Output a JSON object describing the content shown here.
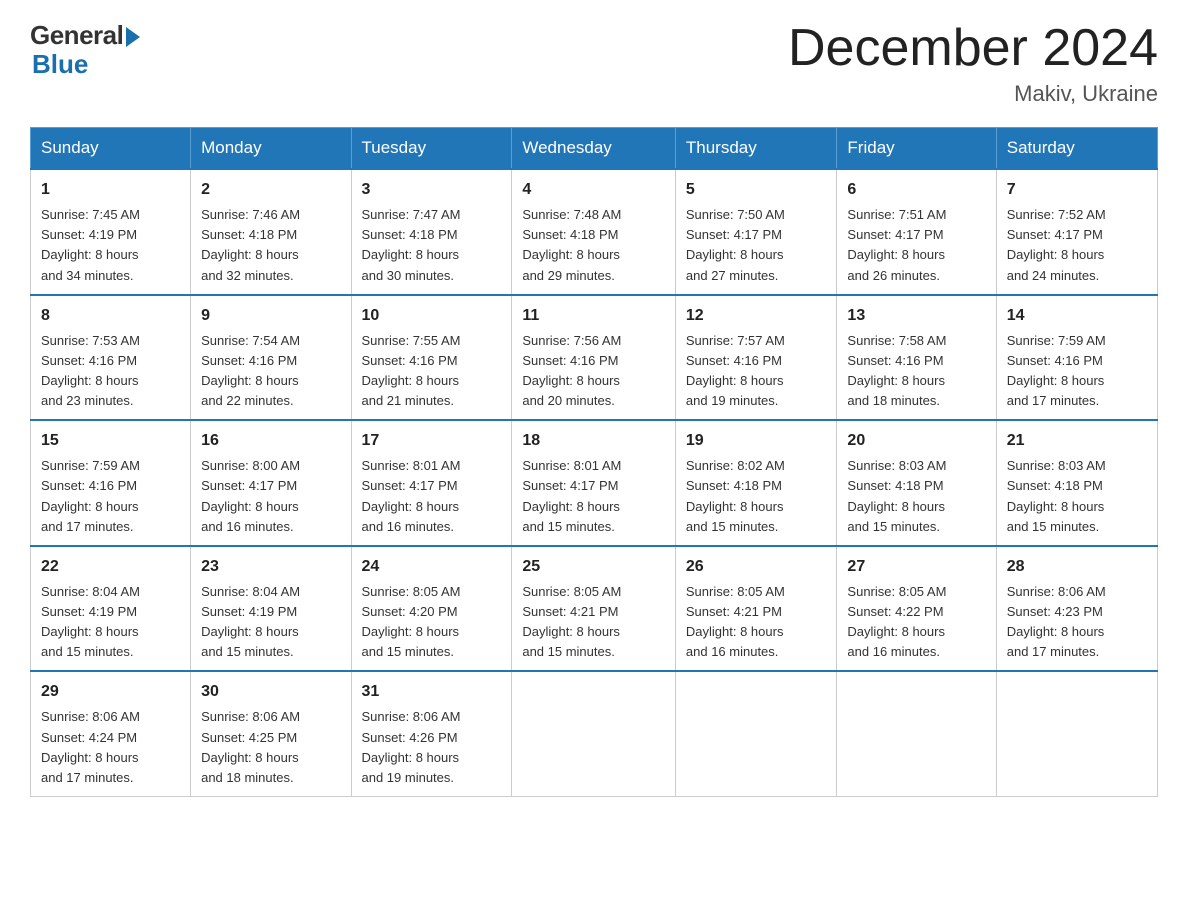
{
  "header": {
    "logo_general": "General",
    "logo_blue": "Blue",
    "month_title": "December 2024",
    "location": "Makiv, Ukraine"
  },
  "weekdays": [
    "Sunday",
    "Monday",
    "Tuesday",
    "Wednesday",
    "Thursday",
    "Friday",
    "Saturday"
  ],
  "weeks": [
    [
      {
        "day": "1",
        "sunrise": "7:45 AM",
        "sunset": "4:19 PM",
        "daylight": "8 hours and 34 minutes."
      },
      {
        "day": "2",
        "sunrise": "7:46 AM",
        "sunset": "4:18 PM",
        "daylight": "8 hours and 32 minutes."
      },
      {
        "day": "3",
        "sunrise": "7:47 AM",
        "sunset": "4:18 PM",
        "daylight": "8 hours and 30 minutes."
      },
      {
        "day": "4",
        "sunrise": "7:48 AM",
        "sunset": "4:18 PM",
        "daylight": "8 hours and 29 minutes."
      },
      {
        "day": "5",
        "sunrise": "7:50 AM",
        "sunset": "4:17 PM",
        "daylight": "8 hours and 27 minutes."
      },
      {
        "day": "6",
        "sunrise": "7:51 AM",
        "sunset": "4:17 PM",
        "daylight": "8 hours and 26 minutes."
      },
      {
        "day": "7",
        "sunrise": "7:52 AM",
        "sunset": "4:17 PM",
        "daylight": "8 hours and 24 minutes."
      }
    ],
    [
      {
        "day": "8",
        "sunrise": "7:53 AM",
        "sunset": "4:16 PM",
        "daylight": "8 hours and 23 minutes."
      },
      {
        "day": "9",
        "sunrise": "7:54 AM",
        "sunset": "4:16 PM",
        "daylight": "8 hours and 22 minutes."
      },
      {
        "day": "10",
        "sunrise": "7:55 AM",
        "sunset": "4:16 PM",
        "daylight": "8 hours and 21 minutes."
      },
      {
        "day": "11",
        "sunrise": "7:56 AM",
        "sunset": "4:16 PM",
        "daylight": "8 hours and 20 minutes."
      },
      {
        "day": "12",
        "sunrise": "7:57 AM",
        "sunset": "4:16 PM",
        "daylight": "8 hours and 19 minutes."
      },
      {
        "day": "13",
        "sunrise": "7:58 AM",
        "sunset": "4:16 PM",
        "daylight": "8 hours and 18 minutes."
      },
      {
        "day": "14",
        "sunrise": "7:59 AM",
        "sunset": "4:16 PM",
        "daylight": "8 hours and 17 minutes."
      }
    ],
    [
      {
        "day": "15",
        "sunrise": "7:59 AM",
        "sunset": "4:16 PM",
        "daylight": "8 hours and 17 minutes."
      },
      {
        "day": "16",
        "sunrise": "8:00 AM",
        "sunset": "4:17 PM",
        "daylight": "8 hours and 16 minutes."
      },
      {
        "day": "17",
        "sunrise": "8:01 AM",
        "sunset": "4:17 PM",
        "daylight": "8 hours and 16 minutes."
      },
      {
        "day": "18",
        "sunrise": "8:01 AM",
        "sunset": "4:17 PM",
        "daylight": "8 hours and 15 minutes."
      },
      {
        "day": "19",
        "sunrise": "8:02 AM",
        "sunset": "4:18 PM",
        "daylight": "8 hours and 15 minutes."
      },
      {
        "day": "20",
        "sunrise": "8:03 AM",
        "sunset": "4:18 PM",
        "daylight": "8 hours and 15 minutes."
      },
      {
        "day": "21",
        "sunrise": "8:03 AM",
        "sunset": "4:18 PM",
        "daylight": "8 hours and 15 minutes."
      }
    ],
    [
      {
        "day": "22",
        "sunrise": "8:04 AM",
        "sunset": "4:19 PM",
        "daylight": "8 hours and 15 minutes."
      },
      {
        "day": "23",
        "sunrise": "8:04 AM",
        "sunset": "4:19 PM",
        "daylight": "8 hours and 15 minutes."
      },
      {
        "day": "24",
        "sunrise": "8:05 AM",
        "sunset": "4:20 PM",
        "daylight": "8 hours and 15 minutes."
      },
      {
        "day": "25",
        "sunrise": "8:05 AM",
        "sunset": "4:21 PM",
        "daylight": "8 hours and 15 minutes."
      },
      {
        "day": "26",
        "sunrise": "8:05 AM",
        "sunset": "4:21 PM",
        "daylight": "8 hours and 16 minutes."
      },
      {
        "day": "27",
        "sunrise": "8:05 AM",
        "sunset": "4:22 PM",
        "daylight": "8 hours and 16 minutes."
      },
      {
        "day": "28",
        "sunrise": "8:06 AM",
        "sunset": "4:23 PM",
        "daylight": "8 hours and 17 minutes."
      }
    ],
    [
      {
        "day": "29",
        "sunrise": "8:06 AM",
        "sunset": "4:24 PM",
        "daylight": "8 hours and 17 minutes."
      },
      {
        "day": "30",
        "sunrise": "8:06 AM",
        "sunset": "4:25 PM",
        "daylight": "8 hours and 18 minutes."
      },
      {
        "day": "31",
        "sunrise": "8:06 AM",
        "sunset": "4:26 PM",
        "daylight": "8 hours and 19 minutes."
      },
      null,
      null,
      null,
      null
    ]
  ],
  "labels": {
    "sunrise": "Sunrise: ",
    "sunset": "Sunset: ",
    "daylight": "Daylight: "
  }
}
